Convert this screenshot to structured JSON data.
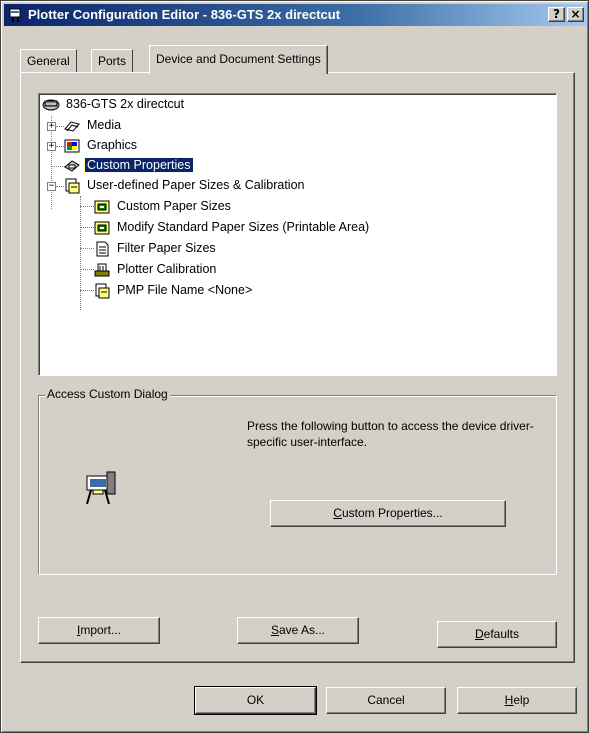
{
  "window": {
    "title": "Plotter Configuration Editor - 836-GTS 2x directcut",
    "help_button": "?",
    "close_button": "×"
  },
  "tabs": [
    {
      "label": "General"
    },
    {
      "label": "Ports"
    },
    {
      "label": "Device and Document Settings",
      "active": true
    }
  ],
  "tree": {
    "root": "836-GTS 2x directcut",
    "items": [
      {
        "label": "Media",
        "icon": "media-icon"
      },
      {
        "label": "Graphics",
        "icon": "graphics-icon"
      },
      {
        "label": "Custom Properties",
        "icon": "custom-properties-icon",
        "selected": true
      },
      {
        "label": "User-defined Paper Sizes & Calibration",
        "icon": "paper-sizes-icon"
      }
    ],
    "sub_items": [
      {
        "label": "Custom Paper Sizes",
        "icon": "custom-paper-icon"
      },
      {
        "label": "Modify Standard Paper Sizes (Printable Area)",
        "icon": "modify-paper-icon"
      },
      {
        "label": "Filter Paper Sizes",
        "icon": "filter-paper-icon"
      },
      {
        "label": "Plotter Calibration",
        "icon": "calibration-icon"
      },
      {
        "label": "PMP File Name <None>",
        "icon": "pmp-file-icon"
      }
    ]
  },
  "access_group": {
    "legend": "Access Custom Dialog",
    "description": "Press the following button to access the device driver-specific user-interface.",
    "button_prefix": "C",
    "button_rest": "ustom Properties..."
  },
  "panel_buttons": {
    "import_u": "I",
    "import_rest": "mport...",
    "saveas_u": "S",
    "saveas_rest": "ave As...",
    "defaults_u": "D",
    "defaults_rest": "efaults"
  },
  "footer": {
    "ok": "OK",
    "cancel": "Cancel",
    "help_u": "H",
    "help_rest": "elp"
  }
}
